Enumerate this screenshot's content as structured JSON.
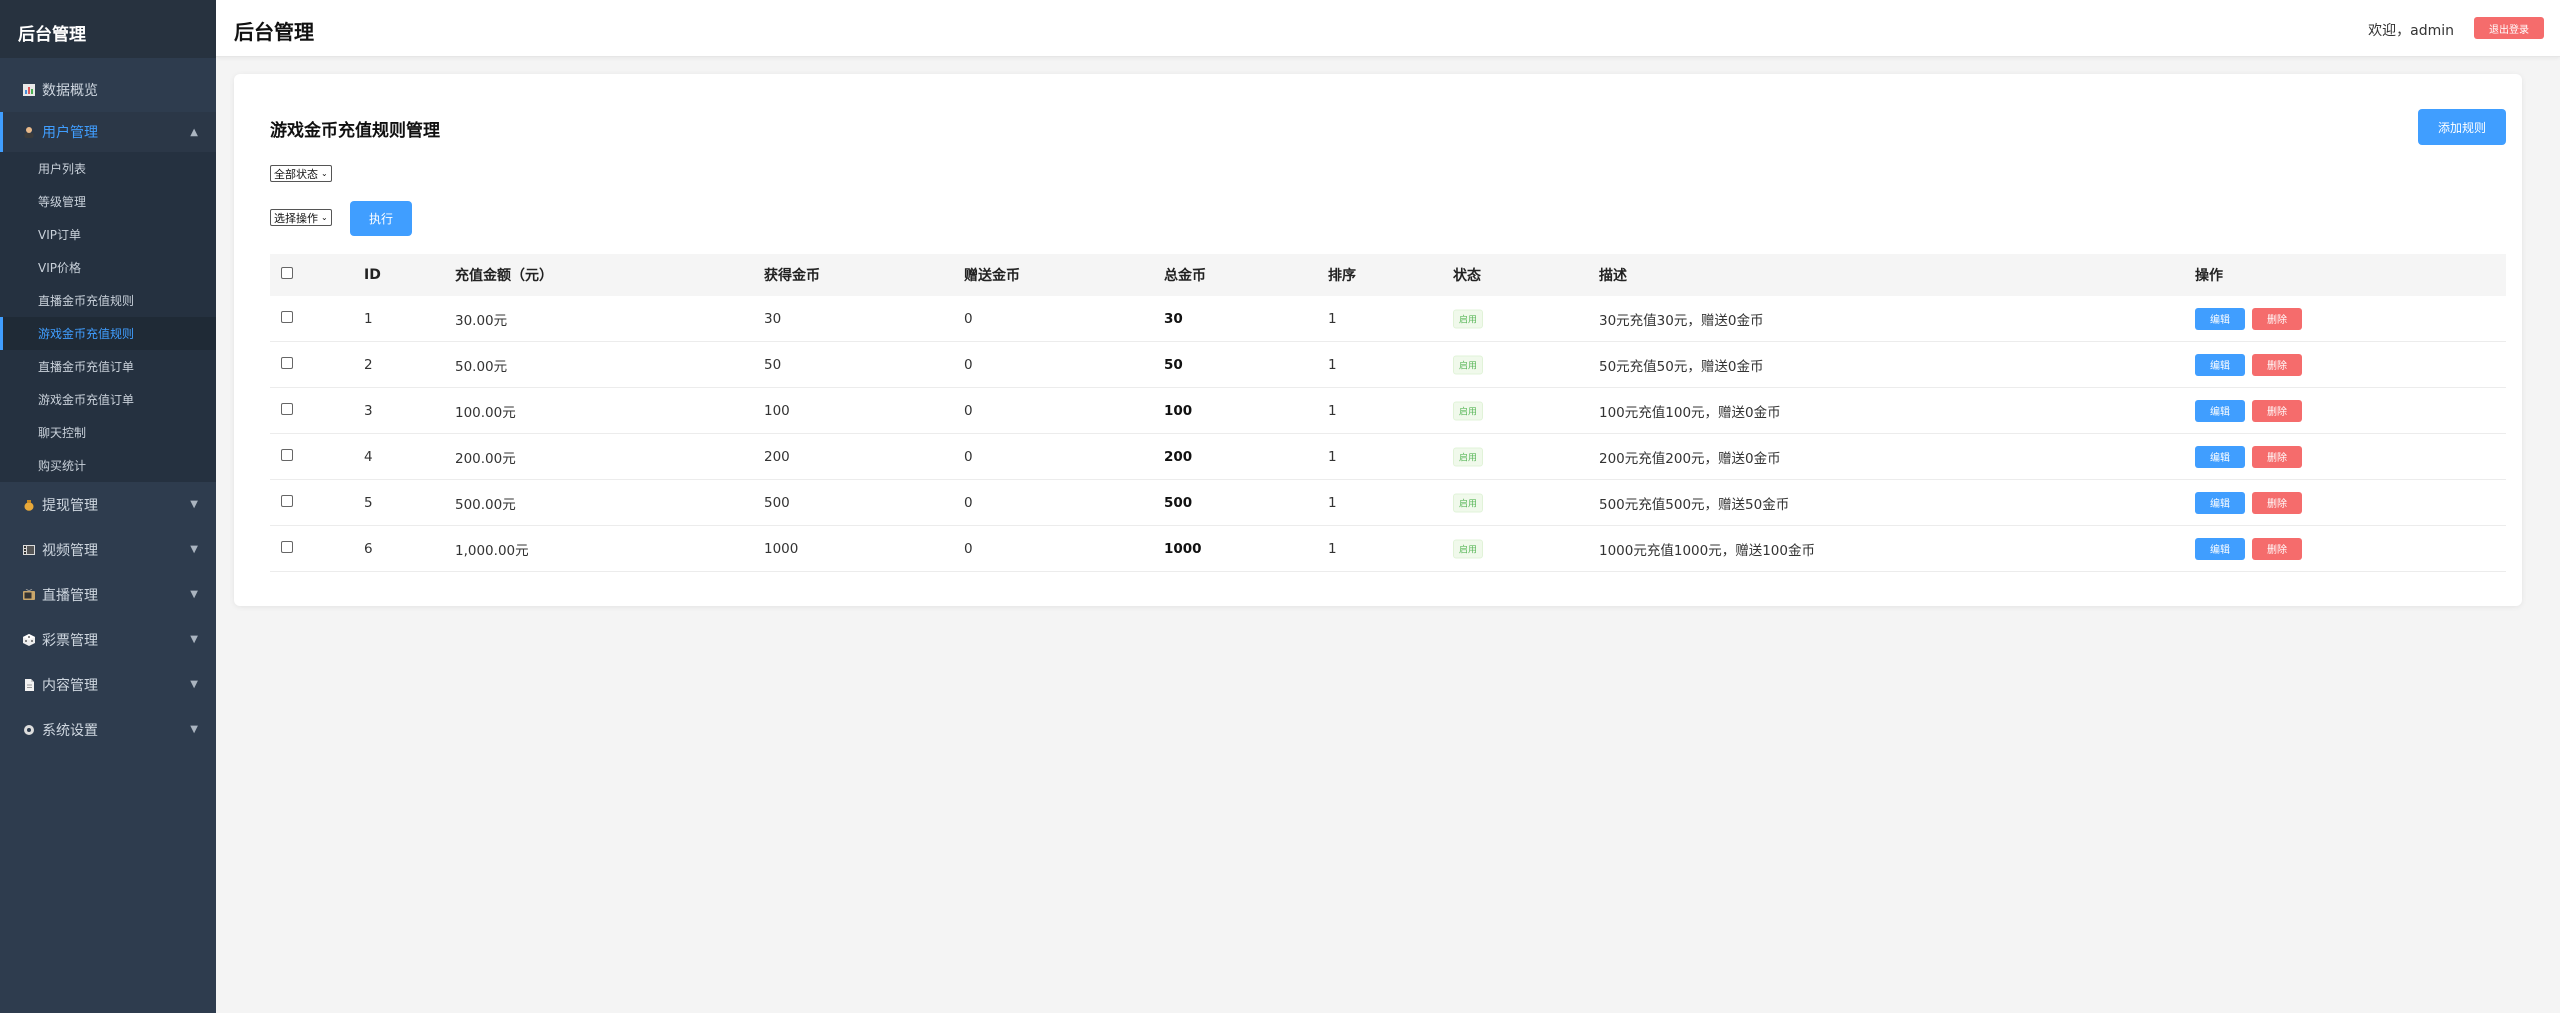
{
  "sidebar": {
    "brand": "后台管理",
    "items": [
      {
        "label": "数据概览",
        "icon": "chart-icon"
      },
      {
        "label": "用户管理",
        "icon": "user-icon"
      },
      {
        "label": "提现管理",
        "icon": "money-bag-icon"
      },
      {
        "label": "视频管理",
        "icon": "video-icon"
      },
      {
        "label": "直播管理",
        "icon": "tv-icon"
      },
      {
        "label": "彩票管理",
        "icon": "dice-icon"
      },
      {
        "label": "内容管理",
        "icon": "document-icon"
      },
      {
        "label": "系统设置",
        "icon": "gear-icon"
      }
    ],
    "subitems": [
      "用户列表",
      "等级管理",
      "VIP订单",
      "VIP价格",
      "直播金币充值规则",
      "游戏金币充值规则",
      "直播金币充值订单",
      "游戏金币充值订单",
      "聊天控制",
      "购买统计"
    ]
  },
  "header": {
    "title": "后台管理",
    "welcome": "欢迎，admin",
    "logout": "退出登录"
  },
  "main": {
    "title": "游戏金币充值规则管理",
    "add_button": "添加规则",
    "status_filter": "全部状态",
    "action_select": "选择操作",
    "execute_button": "执行"
  },
  "table": {
    "headers": [
      "ID",
      "充值金额（元）",
      "获得金币",
      "赠送金币",
      "总金币",
      "排序",
      "状态",
      "描述",
      "操作"
    ],
    "edit_label": "编辑",
    "delete_label": "删除",
    "rows": [
      {
        "id": "1",
        "amount": "30.00元",
        "coins": "30",
        "bonus": "0",
        "total": "30",
        "sort": "1",
        "status": "启用",
        "desc": "30元充值30元，赠送0金币"
      },
      {
        "id": "2",
        "amount": "50.00元",
        "coins": "50",
        "bonus": "0",
        "total": "50",
        "sort": "1",
        "status": "启用",
        "desc": "50元充值50元，赠送0金币"
      },
      {
        "id": "3",
        "amount": "100.00元",
        "coins": "100",
        "bonus": "0",
        "total": "100",
        "sort": "1",
        "status": "启用",
        "desc": "100元充值100元，赠送0金币"
      },
      {
        "id": "4",
        "amount": "200.00元",
        "coins": "200",
        "bonus": "0",
        "total": "200",
        "sort": "1",
        "status": "启用",
        "desc": "200元充值200元，赠送0金币"
      },
      {
        "id": "5",
        "amount": "500.00元",
        "coins": "500",
        "bonus": "0",
        "total": "500",
        "sort": "1",
        "status": "启用",
        "desc": "500元充值500元，赠送50金币"
      },
      {
        "id": "6",
        "amount": "1,000.00元",
        "coins": "1000",
        "bonus": "0",
        "total": "1000",
        "sort": "1",
        "status": "启用",
        "desc": "1000元充值1000元，赠送100金币"
      }
    ]
  },
  "colors": {
    "sidebar_bg": "#2e3c4e",
    "accent": "#409eff",
    "danger": "#f56c6c",
    "success": "#5cb85c"
  }
}
